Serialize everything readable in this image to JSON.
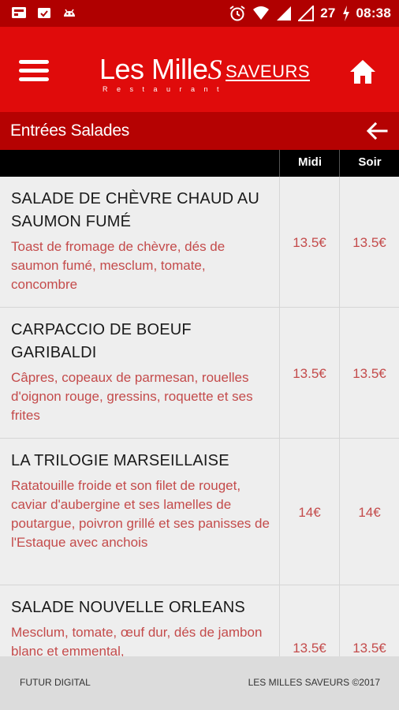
{
  "status_bar": {
    "battery": "27",
    "time": "08:38",
    "icons": [
      "gallery-icon",
      "sync-icon",
      "android-icon",
      "alarm-icon",
      "wifi-icon",
      "signal-icon",
      "no-signal-icon",
      "battery-charging-icon"
    ]
  },
  "app_bar": {
    "logo_main": "Les Mille",
    "logo_s": "S",
    "logo_sub": "SAVEURS",
    "logo_tag": "Restaurant",
    "menu_icon": "hamburger-menu-icon",
    "home_icon": "home-icon"
  },
  "section": {
    "title": "Entrées Salades",
    "back_icon": "arrow-left-icon"
  },
  "table": {
    "columns": [
      "Midi",
      "Soir"
    ],
    "rows": [
      {
        "name": "SALADE DE CHÈVRE CHAUD AU SAUMON FUMÉ",
        "description": "Toast de fromage de chèvre, dés de saumon fumé, mesclum, tomate, concombre",
        "midi": "13.5€",
        "soir": "13.5€"
      },
      {
        "name": "CARPACCIO DE BOEUF GARIBALDI",
        "description": "Câpres, copeaux de parmesan, rouelles d'oignon rouge, gressins, roquette et ses frites",
        "midi": "13.5€",
        "soir": "13.5€"
      },
      {
        "name": "LA TRILOGIE MARSEILLAISE",
        "description": "Ratatouille froide et son filet de rouget, caviar d'aubergine et ses lamelles de poutargue, poivron grillé et ses panisses de l'Estaque avec anchois",
        "midi": "14€",
        "soir": "14€"
      },
      {
        "name": "SALADE NOUVELLE ORLEANS",
        "description": "Mesclum, tomate, œuf dur, dés de jambon blanc et emmental,",
        "midi": "13.5€",
        "soir": "13.5€"
      }
    ]
  },
  "footer": {
    "left": "FUTUR DIGITAL",
    "right": "LES MILLES SAVEURS ©2017"
  },
  "colors": {
    "app_bar": "#e00b0b",
    "section": "#b50202",
    "status_bar": "#b00000",
    "price": "#c44b4b"
  }
}
